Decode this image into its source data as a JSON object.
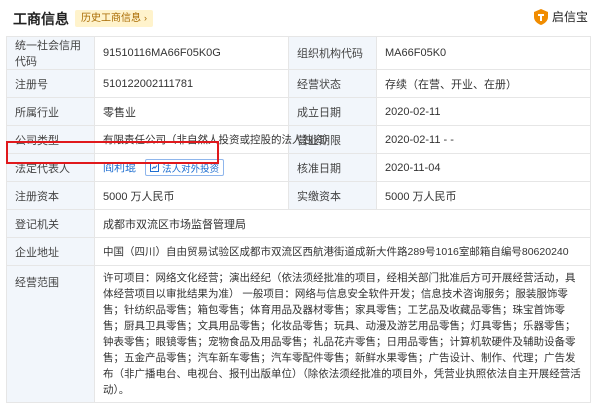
{
  "header": {
    "title": "工商信息",
    "history_tag": "历史工商信息",
    "brand": "启信宝"
  },
  "rows": [
    {
      "l1": "统一社会信用代码",
      "v1": "91510116MA66F05K0G",
      "l2": "组织机构代码",
      "v2": "MA66F05K0"
    },
    {
      "l1": "注册号",
      "v1": "510122002111781",
      "l2": "经营状态",
      "v2": "存续（在营、开业、在册）"
    },
    {
      "l1": "所属行业",
      "v1": "零售业",
      "l2": "成立日期",
      "v2": "2020-02-11"
    },
    {
      "l1": "公司类型",
      "v1": "有限责任公司（非自然人投资或控股的法人独资）",
      "l2": "营业期限",
      "v2": "2020-02-11 - -"
    },
    {
      "l1": "法定代表人",
      "v1": "阎利琨",
      "btn": "法人对外投资",
      "l2": "核准日期",
      "v2": "2020-11-04"
    },
    {
      "l1": "注册资本",
      "v1": "5000 万人民币",
      "l2": "实缴资本",
      "v2": "5000 万人民币"
    }
  ],
  "authority": {
    "label": "登记机关",
    "value": "成都市双流区市场监督管理局"
  },
  "address": {
    "label": "企业地址",
    "value": "中国（四川）自由贸易试验区成都市双流区西航港街道成新大件路289号1016室邮箱自编号80620240"
  },
  "scope": {
    "label": "经营范围",
    "value": "许可项目：网络文化经营；演出经纪（依法须经批准的项目，经相关部门批准后方可开展经营活动，具体经营项目以审批结果为准） 一般项目：网络与信息安全软件开发；信息技术咨询服务；服装服饰零售；针纺织品零售；箱包零售；体育用品及器材零售；家具零售；工艺品及收藏品零售；珠宝首饰零售；厨具卫具零售；文具用品零售；化妆品零售；玩具、动漫及游艺用品零售；灯具零售；乐器零售；钟表零售；眼镜零售；宠物食品及用品零售；礼品花卉零售；日用品零售；计算机软硬件及辅助设备零售；五金产品零售；汽车新车零售；汽车零配件零售；新鲜水果零售；广告设计、制作、代理；广告发布（非广播电台、电视台、报刊出版单位）（除依法须经批准的项目外，凭营业执照依法自主开展经营活动）。"
  }
}
